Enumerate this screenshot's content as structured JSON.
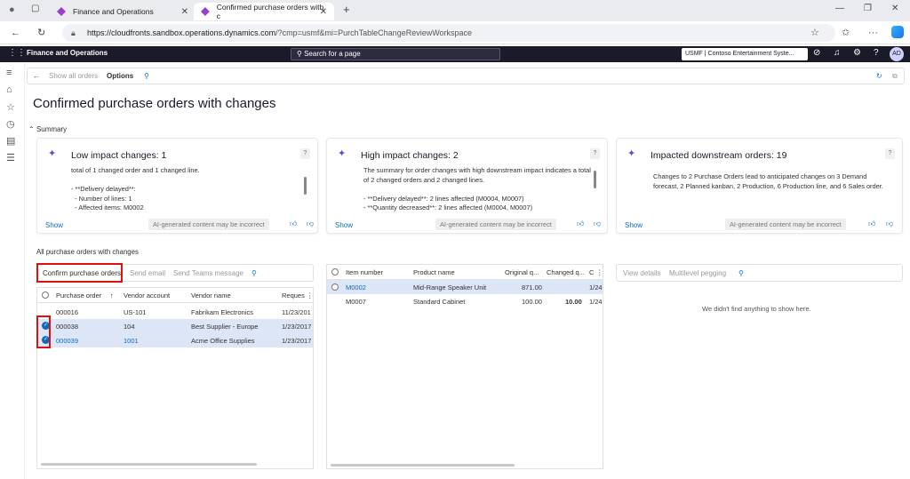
{
  "browser": {
    "tabs": [
      {
        "label": "Finance and Operations"
      },
      {
        "label": "Confirmed purchase orders with c"
      }
    ],
    "url_host": "https://cloudfronts.sandbox.operations.dynamics.com",
    "url_path": "/?cmp=usmf&mi=PurchTableChangeReviewWorkspace"
  },
  "header": {
    "app_title": "Finance and Operations",
    "search_placeholder": "Search for a page",
    "company": "USMF | Contoso Entertainment Syste...",
    "avatar": "AD"
  },
  "actionbar": {
    "show_all": "Show all orders",
    "options": "Options"
  },
  "page": {
    "title": "Confirmed purchase orders with changes",
    "summary_label": "Summary",
    "section_label": "All purchase orders with changes"
  },
  "cards": [
    {
      "title": "Low impact changes: 1",
      "body": "total of 1 changed order and 1 changed line.\n\n- **Delivery delayed**:\n  - Number of lines: 1\n  - Affected items: M0002",
      "show": "Show",
      "ai": "AI-generated content may be incorrect"
    },
    {
      "title": "High impact changes: 2",
      "body": "The summary for order changes with high downstream impact indicates a total of 2 changed orders and 2 changed lines.\n\n- **Delivery delayed**: 2 lines affected (M0004, M0007)\n- **Quantity decreased**: 2 lines affected (M0004, M0007)",
      "show": "Show",
      "ai": "AI-generated content may be incorrect"
    },
    {
      "title": "Impacted downstream orders: 19",
      "body": "Changes to 2 Purchase Orders lead to anticipated changes on 3 Demand forecast, 2 Planned kanban, 2 Production, 6 Production line, and 6 Sales order.",
      "show": "Show",
      "ai": "AI-generated content may be incorrect"
    }
  ],
  "po_grid": {
    "toolbar": {
      "confirm": "Confirm purchase orders",
      "email": "Send email",
      "teams": "Send Teams message"
    },
    "columns": [
      "Purchase order",
      "Vendor account",
      "Vendor name",
      "Reques"
    ],
    "rows": [
      {
        "po": "000016",
        "vendor": "US-101",
        "name": "Fabrikam Electronics",
        "date": "11/23/201"
      },
      {
        "po": "000038",
        "vendor": "104",
        "name": "Best Supplier - Europe",
        "date": "1/23/2017"
      },
      {
        "po": "000039",
        "vendor": "1001",
        "name": "Acme Office Supplies",
        "date": "1/23/2017"
      }
    ]
  },
  "line_grid": {
    "columns": [
      "Item number",
      "Product name",
      "Original q...",
      "Changed q...",
      "C"
    ],
    "rows": [
      {
        "item": "M0002",
        "product": "Mid-Range Speaker Unit",
        "orig": "871.00",
        "changed": "",
        "c": "1/24"
      },
      {
        "item": "M0007",
        "product": "Standard Cabinet",
        "orig": "100.00",
        "changed": "10.00",
        "c": "1/24"
      }
    ]
  },
  "detail_pane": {
    "view_details": "View details",
    "pegging": "Multilevel pegging",
    "empty": "We didn't find anything to show here."
  }
}
